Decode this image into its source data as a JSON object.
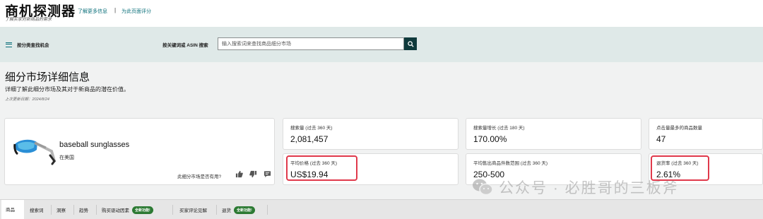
{
  "header": {
    "title": "商机探测器",
    "subtitle": "了解买家对新商品的需求",
    "link_learn_more": "了解更多信息",
    "separator": "|",
    "link_rate": "为此页面评分"
  },
  "searchbar": {
    "category_label": "按分类查找机会",
    "keyword_label": "按关键词或 ASIN 搜索",
    "search_placeholder": "输入搜索词来查找商品细分市场"
  },
  "page": {
    "title": "细分市场详细信息",
    "description": "详细了解此细分市场及其对于新商品的潜在价值。",
    "updated": "上次更新日期：2024/8/24"
  },
  "product": {
    "name": "baseball sunglasses",
    "region": "在美国",
    "feedback_question": "此细分市场是否有用?"
  },
  "metrics": {
    "search_volume": {
      "label": "搜索量 (过去 360 天)",
      "value": "2,081,457"
    },
    "search_growth": {
      "label": "搜索量增长 (过去 180 天)",
      "value": "170.00%"
    },
    "top_clicked": {
      "label": "点击量最多的商品数量",
      "value": "47"
    },
    "avg_price": {
      "label": "平均价格 (过去 360 天)",
      "value": "US$19.94"
    },
    "units_range": {
      "label": "平均售出商品件数范围 (过去 360 天)",
      "value": "250-500"
    },
    "return_rate": {
      "label": "退货率 (过去 360 天)",
      "value": "2.61%"
    }
  },
  "watermark": {
    "text": "公众号 · 必胜哥的三板斧"
  },
  "tabs": [
    {
      "label": "商品"
    },
    {
      "label": "搜索词"
    },
    {
      "label": "洞察"
    },
    {
      "label": "趋势"
    },
    {
      "label": "购买驱动因素",
      "badge": "全新功能!"
    },
    {
      "label": "买家评论见解"
    },
    {
      "label": "退货",
      "badge": "全新功能!"
    }
  ],
  "colors": {
    "accent": "#0a6f7a",
    "highlight": "#e0394b",
    "badge": "#2c7a33"
  }
}
